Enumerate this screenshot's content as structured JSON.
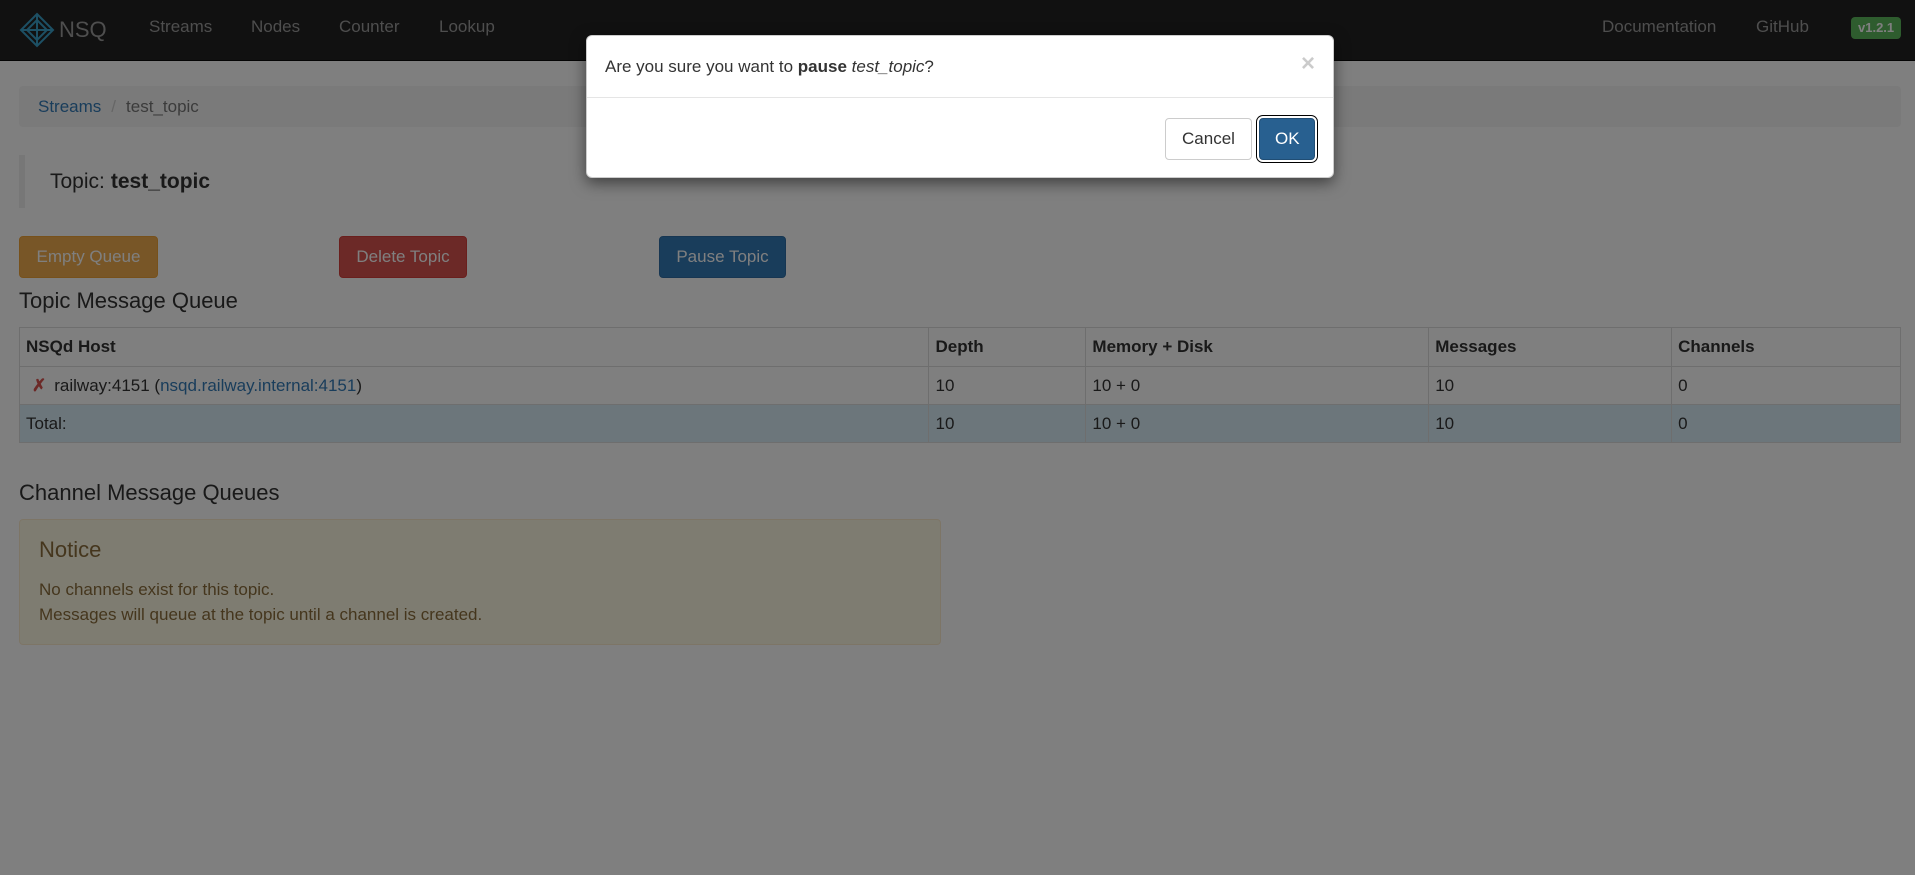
{
  "navbar": {
    "brand": "NSQ",
    "links": [
      "Streams",
      "Nodes",
      "Counter",
      "Lookup"
    ],
    "right_links": [
      "Documentation",
      "GitHub"
    ],
    "version": "v1.2.1"
  },
  "breadcrumb": {
    "root": "Streams",
    "current": "test_topic"
  },
  "topic": {
    "label": "Topic:",
    "name": "test_topic"
  },
  "actions": {
    "empty_queue": "Empty Queue",
    "delete_topic": "Delete Topic",
    "pause_topic": "Pause Topic"
  },
  "topic_queue": {
    "title": "Topic Message Queue",
    "headers": [
      "NSQd Host",
      "Depth",
      "Memory + Disk",
      "Messages",
      "Channels"
    ],
    "rows": [
      {
        "status_icon": "x-mark-icon",
        "status_mark": "✗",
        "host": "railway:4151",
        "host_open": " (",
        "host_link": "nsqd.railway.internal:4151",
        "host_close": ")",
        "depth": "10",
        "memory_disk": "10 + 0",
        "messages": "10",
        "channels": "0"
      }
    ],
    "total": {
      "label": "Total:",
      "depth": "10",
      "memory_disk": "10 + 0",
      "messages": "10",
      "channels": "0"
    }
  },
  "channel_queues": {
    "title": "Channel Message Queues",
    "notice": {
      "heading": "Notice",
      "line1": "No channels exist for this topic.",
      "line2": "Messages will queue at the topic until a channel is created."
    }
  },
  "modal": {
    "prefix": "Are you sure you want to ",
    "action": "pause",
    "space": " ",
    "target": "test_topic",
    "suffix": "?",
    "close": "×",
    "cancel": "Cancel",
    "ok": "OK"
  },
  "colors": {
    "navbar": "#222222",
    "link": "#337ab7",
    "warning": "#f0ad4e",
    "danger": "#d9534f",
    "primary": "#337ab7",
    "version_badge": "#5cb85c"
  }
}
